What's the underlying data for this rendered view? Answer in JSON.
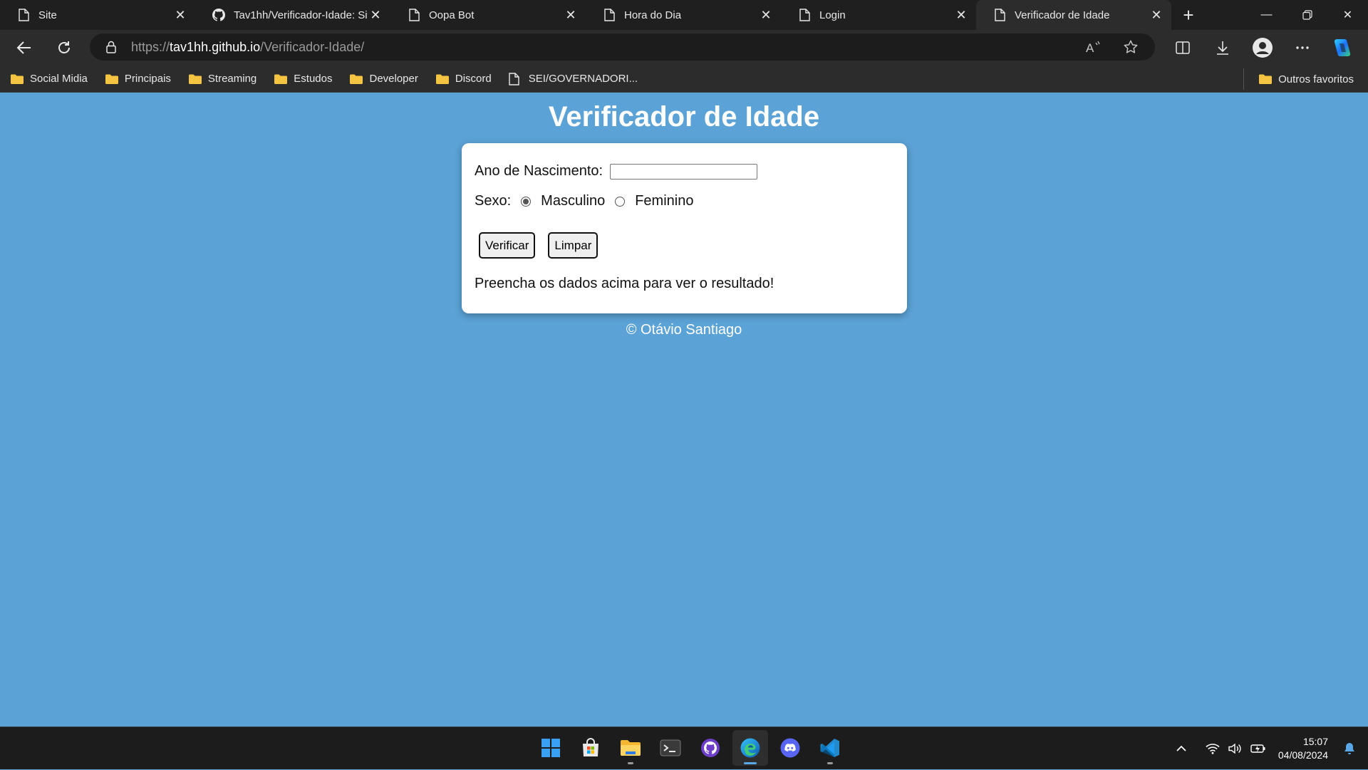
{
  "browser": {
    "tabs": [
      {
        "label": "Site",
        "icon": "page-icon",
        "active": false
      },
      {
        "label": "Tav1hh/Verificador-Idade: Site",
        "icon": "github-icon",
        "active": false
      },
      {
        "label": "Oopa Bot",
        "icon": "page-icon",
        "active": false
      },
      {
        "label": "Hora do Dia",
        "icon": "page-icon",
        "active": false
      },
      {
        "label": "Login",
        "icon": "page-icon",
        "active": false
      },
      {
        "label": "Verificador de Idade",
        "icon": "page-icon",
        "active": true
      }
    ],
    "address": {
      "scheme": "https://",
      "host": "tav1hh.github.io",
      "path": "/Verificador-Idade/"
    },
    "bookmarks": [
      {
        "label": "Social Midia",
        "icon": "folder-icon"
      },
      {
        "label": "Principais",
        "icon": "folder-icon"
      },
      {
        "label": "Streaming",
        "icon": "folder-icon"
      },
      {
        "label": "Estudos",
        "icon": "folder-icon"
      },
      {
        "label": "Developer",
        "icon": "folder-icon"
      },
      {
        "label": "Discord",
        "icon": "folder-icon"
      },
      {
        "label": "SEI/GOVERNADORI...",
        "icon": "page-icon"
      }
    ],
    "other_favorites": "Outros favoritos"
  },
  "page": {
    "title": "Verificador de Idade",
    "form": {
      "year_label": "Ano de Nascimento:",
      "year_value": "",
      "sex_label": "Sexo:",
      "options": [
        {
          "label": "Masculino",
          "checked": true
        },
        {
          "label": "Feminino",
          "checked": false
        }
      ],
      "verify_button": "Verificar",
      "clear_button": "Limpar",
      "result_text": "Preencha os dados acima para ver o resultado!"
    },
    "footer": "© Otávio Santiago"
  },
  "taskbar": {
    "apps": [
      "windows-start-icon",
      "microsoft-store-icon",
      "file-explorer-icon",
      "terminal-icon",
      "github-desktop-icon",
      "edge-icon",
      "discord-icon",
      "vscode-icon"
    ],
    "time": "15:07",
    "date": "04/08/2024"
  },
  "colors": {
    "page_background": "#5ba2d6",
    "browser_chrome": "#2c2c2c",
    "taskbar": "#1c1c1c"
  }
}
